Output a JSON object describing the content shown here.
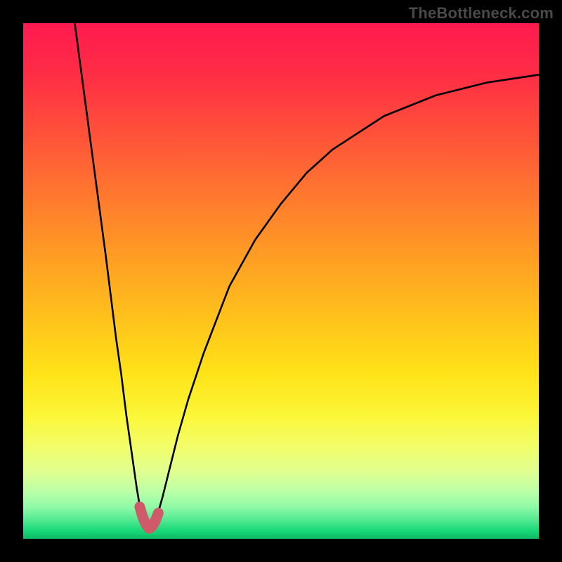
{
  "watermark": "TheBottleneck.com",
  "colors": {
    "curve": "#000000",
    "optimal": "#cf5a69",
    "gradient_stops": [
      {
        "offset": 0.0,
        "color": "#ff1a4f"
      },
      {
        "offset": 0.1,
        "color": "#ff2d45"
      },
      {
        "offset": 0.22,
        "color": "#ff5339"
      },
      {
        "offset": 0.34,
        "color": "#ff7a2e"
      },
      {
        "offset": 0.46,
        "color": "#ff9f23"
      },
      {
        "offset": 0.58,
        "color": "#ffc41b"
      },
      {
        "offset": 0.68,
        "color": "#ffe319"
      },
      {
        "offset": 0.76,
        "color": "#fbf637"
      },
      {
        "offset": 0.82,
        "color": "#f2fd68"
      },
      {
        "offset": 0.87,
        "color": "#dfff90"
      },
      {
        "offset": 0.91,
        "color": "#baffa8"
      },
      {
        "offset": 0.94,
        "color": "#8cf9a6"
      },
      {
        "offset": 0.965,
        "color": "#4ee88f"
      },
      {
        "offset": 0.985,
        "color": "#17d878"
      },
      {
        "offset": 1.0,
        "color": "#0fb765"
      }
    ]
  },
  "chart_data": {
    "type": "line",
    "title": "",
    "xlabel": "",
    "ylabel": "",
    "xlim": [
      0,
      100
    ],
    "ylim": [
      0,
      100
    ],
    "grid": false,
    "legend": false,
    "series": [
      {
        "name": "bottleneck-curve",
        "x": [
          10,
          12,
          14,
          16,
          17,
          18,
          19,
          20,
          21,
          22,
          22.5,
          23,
          23.5,
          24,
          24.5,
          25,
          25.5,
          26,
          27,
          28,
          30,
          32,
          35,
          40,
          45,
          50,
          55,
          60,
          70,
          80,
          90,
          100
        ],
        "y": [
          100,
          85,
          70,
          55,
          47,
          39,
          32,
          24,
          17,
          10,
          7,
          4.5,
          3,
          2.2,
          2.0,
          2.2,
          3,
          4.5,
          8,
          12,
          20,
          27,
          36,
          49,
          58,
          65,
          71,
          75.5,
          82,
          86,
          88.5,
          90
        ],
        "color": "#000000",
        "stroke_width": 2.6
      },
      {
        "name": "optimal-segment",
        "x": [
          22.6,
          23.2,
          23.8,
          24.4,
          25.0,
          25.6,
          26.2
        ],
        "y": [
          6.2,
          4.2,
          2.8,
          2.0,
          2.4,
          3.4,
          5.0
        ],
        "color": "#cf5a69",
        "stroke_width": 15
      }
    ],
    "notes": "Values are read from pixel positions; y increases upward (0 bottom, 100 top). The curve represents bottleneck percentage vs. some parameter, reaching minimum near x≈24.5."
  }
}
